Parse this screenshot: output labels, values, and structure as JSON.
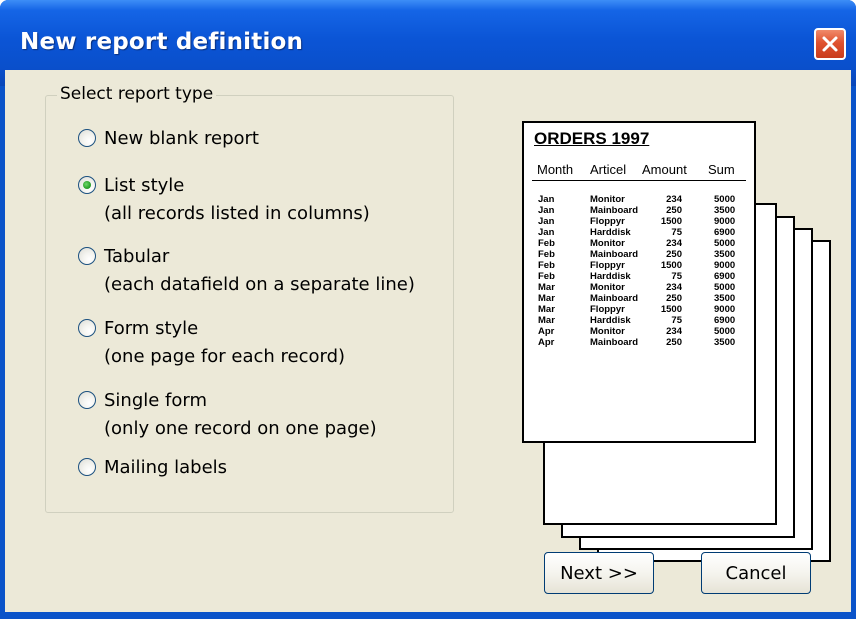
{
  "window": {
    "title": "New report definition",
    "close_icon": "close-icon"
  },
  "group": {
    "label": "Select report type",
    "options": [
      {
        "label": "New blank report",
        "description": "",
        "selected": false
      },
      {
        "label": "List style",
        "description": "(all records listed in columns)",
        "selected": true
      },
      {
        "label": "Tabular",
        "description": "(each datafield on a separate line)",
        "selected": false
      },
      {
        "label": "Form style",
        "description": "(one page for each record)",
        "selected": false
      },
      {
        "label": "Single form",
        "description": "(only one record on one page)",
        "selected": false
      },
      {
        "label": "Mailing labels",
        "description": "",
        "selected": false
      }
    ]
  },
  "preview": {
    "title": "ORDERS 1997",
    "headers": [
      "Month",
      "Articel",
      "Amount",
      "Sum"
    ],
    "rows": [
      [
        "Jan",
        "Monitor",
        "234",
        "5000"
      ],
      [
        "Jan",
        "Mainboard",
        "250",
        "3500"
      ],
      [
        "Jan",
        "Floppyr",
        "1500",
        "9000"
      ],
      [
        "Jan",
        "Harddisk",
        "75",
        "6900"
      ],
      [
        "Feb",
        "Monitor",
        "234",
        "5000"
      ],
      [
        "Feb",
        "Mainboard",
        "250",
        "3500"
      ],
      [
        "Feb",
        "Floppyr",
        "1500",
        "9000"
      ],
      [
        "Feb",
        "Harddisk",
        "75",
        "6900"
      ],
      [
        "Mar",
        "Monitor",
        "234",
        "5000"
      ],
      [
        "Mar",
        "Mainboard",
        "250",
        "3500"
      ],
      [
        "Mar",
        "Floppyr",
        "1500",
        "9000"
      ],
      [
        "Mar",
        "Harddisk",
        "75",
        "6900"
      ],
      [
        "Apr",
        "Monitor",
        "234",
        "5000"
      ],
      [
        "Apr",
        "Mainboard",
        "250",
        "3500"
      ]
    ]
  },
  "buttons": {
    "next": "Next >>",
    "cancel": "Cancel"
  },
  "colors": {
    "titlebar": "#0a53c9",
    "dialog_bg": "#ece9d8",
    "close_button": "#e0522f",
    "radio_selected": "#2aa12a"
  }
}
